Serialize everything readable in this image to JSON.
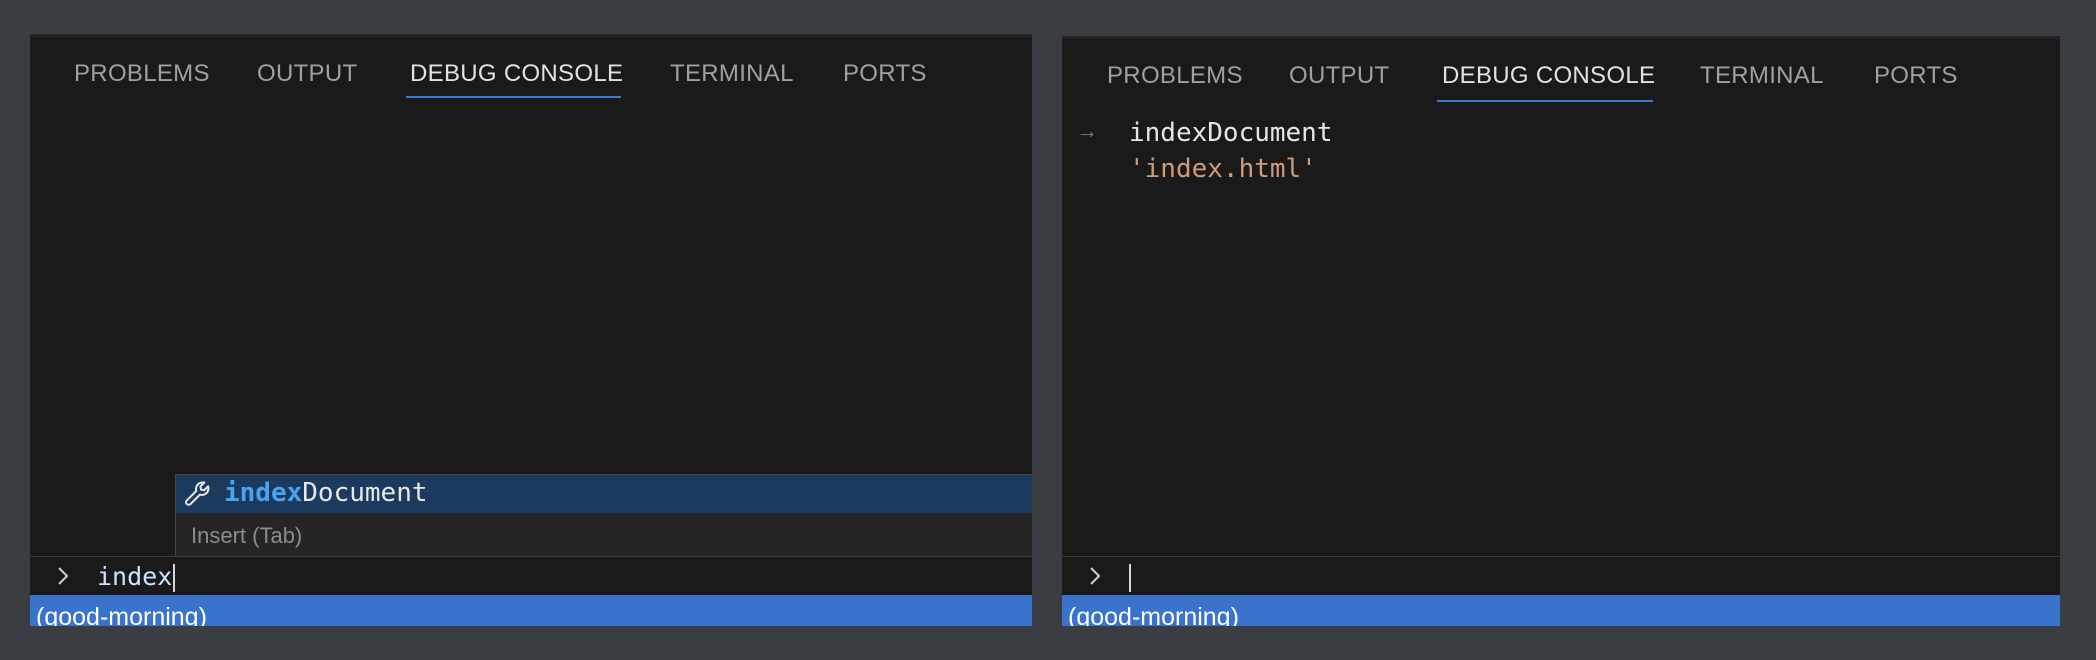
{
  "left_panel": {
    "tabs": [
      {
        "label": "PROBLEMS"
      },
      {
        "label": "OUTPUT"
      },
      {
        "label": "DEBUG CONSOLE"
      },
      {
        "label": "TERMINAL"
      },
      {
        "label": "PORTS"
      }
    ],
    "active_tab": "DEBUG CONSOLE",
    "suggestion": {
      "match": "index",
      "rest": "Document",
      "icon": "wrench-icon",
      "detail": "Insert (Tab)"
    },
    "input_value": "index",
    "status_text": "(good-morning)"
  },
  "right_panel": {
    "tabs": [
      {
        "label": "PROBLEMS"
      },
      {
        "label": "OUTPUT"
      },
      {
        "label": "DEBUG CONSOLE"
      },
      {
        "label": "TERMINAL"
      },
      {
        "label": "PORTS"
      }
    ],
    "active_tab": "DEBUG CONSOLE",
    "output": {
      "arrow": "→",
      "expression": "indexDocument",
      "result": "'index.html'"
    },
    "input_value": "",
    "status_text": "(good-morning)"
  },
  "colors": {
    "accent": "#3a7bd5",
    "status_bar": "#3a73cc",
    "string_value": "#d19a79",
    "match_highlight": "#4aa3f0"
  }
}
